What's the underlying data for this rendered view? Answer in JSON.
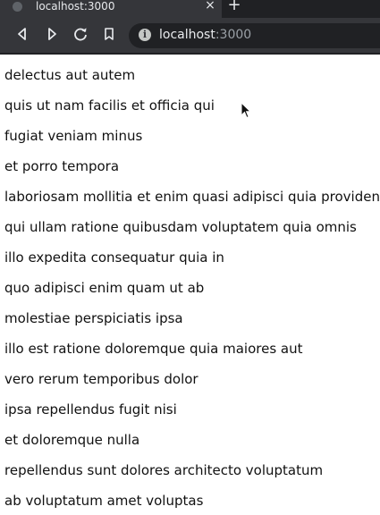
{
  "browser": {
    "tab": {
      "title": "localhost:3000"
    },
    "address_bar": {
      "host": "localhost",
      "port": ":3000"
    }
  },
  "list": {
    "items": [
      "delectus aut autem",
      "quis ut nam facilis et officia qui",
      "fugiat veniam minus",
      "et porro tempora",
      "laboriosam mollitia et enim quasi adipisci quia provident illum",
      "qui ullam ratione quibusdam voluptatem quia omnis",
      "illo expedita consequatur quia in",
      "quo adipisci enim quam ut ab",
      "molestiae perspiciatis ipsa",
      "illo est ratione doloremque quia maiores aut",
      "vero rerum temporibus dolor",
      "ipsa repellendus fugit nisi",
      "et doloremque nulla",
      "repellendus sunt dolores architecto voluptatum",
      "ab voluptatum amet voluptas"
    ]
  },
  "icons": {
    "back": "arrow-left-icon",
    "forward": "arrow-right-icon",
    "reload": "reload-icon",
    "bookmark": "bookmark-icon",
    "site_info": "info-icon",
    "close_tab": "close-icon",
    "new_tab": "plus-icon",
    "cursor": "mouse-pointer-icon"
  },
  "colors": {
    "chrome_dark": "#202124",
    "chrome_toolbar": "#35363a",
    "chrome_text": "#e8eaed",
    "page_bg": "#ffffff",
    "page_text": "#111111"
  }
}
